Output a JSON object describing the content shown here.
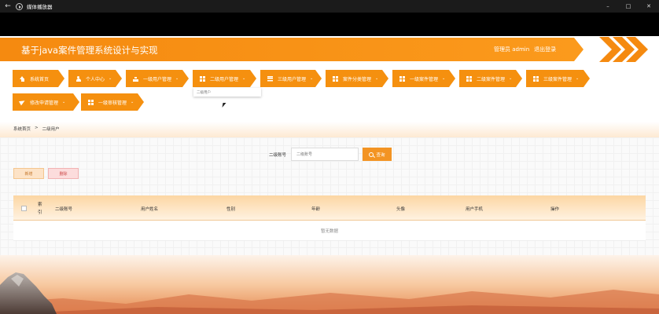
{
  "window": {
    "title": "媒体播放器"
  },
  "header": {
    "site_title": "基于java案件管理系统设计与实现",
    "user_label": "管理员 admin",
    "logout_label": "退出登录"
  },
  "nav": {
    "items": [
      {
        "label": "系统首页",
        "icon": "home-icon"
      },
      {
        "label": "个人中心",
        "icon": "person-icon"
      },
      {
        "label": "一级用户管理",
        "icon": "bar-icon"
      },
      {
        "label": "二级用户管理",
        "icon": "grid-icon"
      },
      {
        "label": "三级用户管理",
        "icon": "list-icon"
      },
      {
        "label": "案件分类管理",
        "icon": "grid-icon"
      },
      {
        "label": "一级案件管理",
        "icon": "grid-icon"
      },
      {
        "label": "二级案件管理",
        "icon": "grid-icon"
      },
      {
        "label": "三级案件管理",
        "icon": "grid-icon"
      },
      {
        "label": "修改申请管理",
        "icon": "send-icon"
      },
      {
        "label": "一级审核管理",
        "icon": "grid-icon"
      }
    ],
    "dropdown_item": "二级用户"
  },
  "breadcrumb": {
    "home": "系统首页",
    "separator": ">",
    "current": "二级用户"
  },
  "search": {
    "label": "二级账号",
    "placeholder": "二级账号",
    "button_label": "查询"
  },
  "actions": {
    "add_label": "新增",
    "delete_label": "删除"
  },
  "table": {
    "index_header": "索引",
    "columns": [
      "二级账号",
      "用户姓名",
      "性别",
      "年龄",
      "头像",
      "用户手机",
      "操作"
    ],
    "empty_text": "暂无数据"
  },
  "colors": {
    "accent": "#f5900f",
    "header_band": "#f58a10"
  }
}
